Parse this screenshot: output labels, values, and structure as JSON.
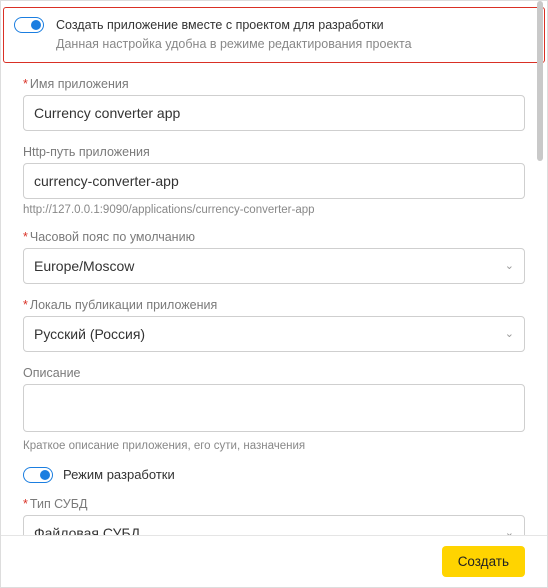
{
  "callout": {
    "title": "Создать приложение вместе с проектом для разработки",
    "subtitle": "Данная настройка удобна в режиме редактирования проекта"
  },
  "fields": {
    "appName": {
      "label": "Имя приложения",
      "value": "Currency converter app"
    },
    "httpPath": {
      "label": "Http-путь приложения",
      "value": "currency-converter-app",
      "preview": "http://127.0.0.1:9090/applications/currency-converter-app"
    },
    "timezone": {
      "label": "Часовой пояс по умолчанию",
      "value": "Europe/Moscow"
    },
    "locale": {
      "label": "Локаль публикации приложения",
      "value": "Русский (Россия)"
    },
    "description": {
      "label": "Описание",
      "value": "",
      "helper": "Краткое описание приложения, его сути, назначения"
    },
    "devMode": {
      "label": "Режим разработки"
    },
    "dbType": {
      "label": "Тип СУБД",
      "value": "Файловая СУБД"
    }
  },
  "footer": {
    "submit": "Создать"
  }
}
